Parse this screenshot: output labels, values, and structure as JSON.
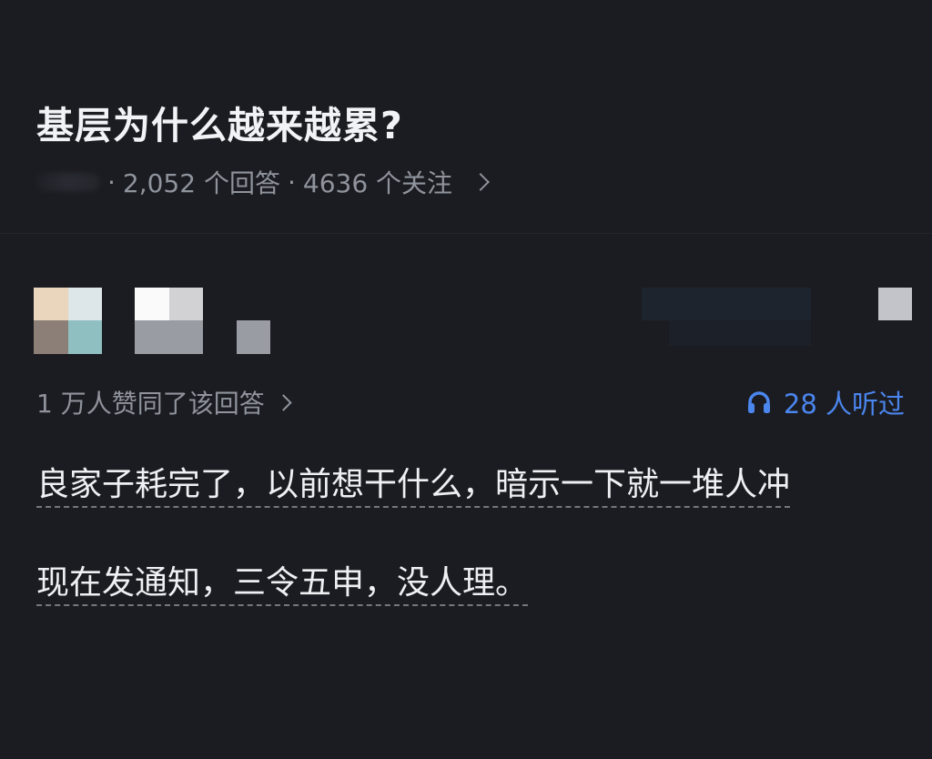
{
  "question": {
    "title": "基层为什么越来越累?",
    "answers": "2,052 个回答",
    "followers": "4636 个关注",
    "separator": "·"
  },
  "answer": {
    "votes": "1 万人赞同了该回答",
    "listen_count": "28 人听过",
    "paragraphs": [
      "良家子耗完了，以前想干什么，暗示一下就一堆人冲",
      "现在发通知，三令五申，没人理。"
    ]
  },
  "colors": {
    "background": "#1b1c21",
    "text": "#eff0f3",
    "muted": "#8f939c",
    "accent": "#4b86ee"
  },
  "icons": {
    "headphones": "headphones-icon",
    "chevron": "chevron-right-icon"
  }
}
